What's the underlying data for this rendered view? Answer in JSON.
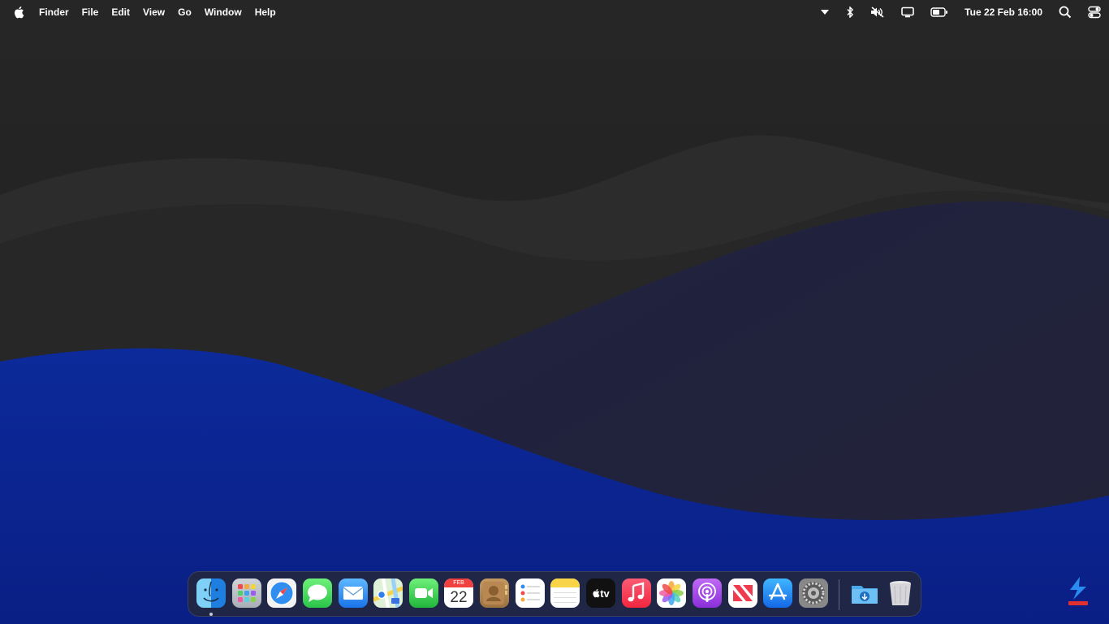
{
  "menubar": {
    "apple_icon": "apple-logo-icon",
    "items": [
      "Finder",
      "File",
      "Edit",
      "View",
      "Go",
      "Window",
      "Help"
    ],
    "status_icons": [
      "dropdown-arrow-icon",
      "bluetooth-icon",
      "volume-muted-icon",
      "display-icon",
      "battery-icon"
    ],
    "clock": "Tue 22 Feb  16:00",
    "search_icon": "spotlight-search-icon",
    "control_center_icon": "control-center-icon"
  },
  "dock": {
    "apps": [
      {
        "name": "Finder",
        "icon": "finder-icon"
      },
      {
        "name": "Launchpad",
        "icon": "launchpad-icon"
      },
      {
        "name": "Safari",
        "icon": "safari-icon"
      },
      {
        "name": "Messages",
        "icon": "messages-icon"
      },
      {
        "name": "Mail",
        "icon": "mail-icon"
      },
      {
        "name": "Maps",
        "icon": "maps-icon"
      },
      {
        "name": "FaceTime",
        "icon": "facetime-icon"
      },
      {
        "name": "Calendar",
        "icon": "calendar-icon"
      },
      {
        "name": "Contacts",
        "icon": "contacts-icon"
      },
      {
        "name": "Reminders",
        "icon": "reminders-icon"
      },
      {
        "name": "Notes",
        "icon": "notes-icon"
      },
      {
        "name": "TV",
        "icon": "apple-tv-icon"
      },
      {
        "name": "Music",
        "icon": "music-icon"
      },
      {
        "name": "Photos",
        "icon": "photos-icon"
      },
      {
        "name": "Podcasts",
        "icon": "podcasts-icon"
      },
      {
        "name": "News",
        "icon": "news-icon"
      },
      {
        "name": "App Store",
        "icon": "app-store-icon"
      },
      {
        "name": "System Preferences",
        "icon": "system-preferences-icon"
      }
    ],
    "calendar": {
      "month": "FEB",
      "day": "22"
    },
    "tv_label": "tv",
    "downloads_icon": "downloads-folder-icon",
    "trash_icon": "trash-icon"
  },
  "colors": {
    "wallpaper_dark": "#262626",
    "wave_blue": "#0b2a9e",
    "menubar_text": "#ffffff",
    "dock_background": "#28282f"
  }
}
